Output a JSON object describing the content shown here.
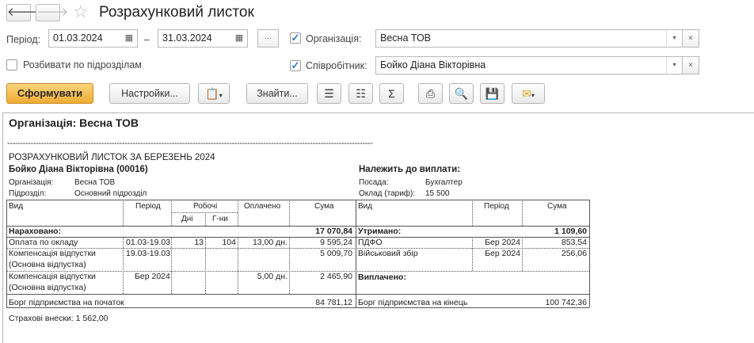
{
  "window": {
    "title": "Розрахунковий листок"
  },
  "filters": {
    "period_label": "Період:",
    "date_from": "01.03.2024",
    "date_sep": "–",
    "date_to": "31.03.2024",
    "more": "...",
    "org_checked": true,
    "org_label": "Організація:",
    "org_value": "Весна ТОВ",
    "split_label": "Розбивати по підрозділам",
    "split_checked": false,
    "emp_checked": true,
    "emp_label": "Співробітник:",
    "emp_value": "Бойко Діана Вікторівна"
  },
  "toolbar": {
    "generate": "Сформувати",
    "settings": "Настройки...",
    "find": "Знайти..."
  },
  "report": {
    "org_header": "Організація: Весна ТОВ",
    "dashes": "--------------------------------------------------------------------------------------------------------------------------------------------",
    "title": "РОЗРАХУНКОВИЙ ЛИСТОК ЗА БЕРЕЗЕНЬ 2024",
    "employee": "Бойко Діана Вікторівна  (00016)",
    "org_label": "Організація:",
    "org_value": "Весна ТОВ",
    "dept_label": "Підрозділ:",
    "dept_value": "Основний підрозділ",
    "payable_label": "Належить до виплати:",
    "position_label": "Посада:",
    "position_value": "Бухгалтер",
    "salary_label": "Оклад (тариф):",
    "salary_value": "15 500",
    "columns": {
      "kind": "Вид",
      "period": "Період",
      "working": "Робочі",
      "days": "Дні",
      "hours": "Г-ни",
      "paid": "Оплачено",
      "sum": "Сума",
      "kind2": "Вид",
      "period2": "Період",
      "sum2": "Сума"
    },
    "accrued_label": "Нараховано:",
    "accrued_total": "17 070,84",
    "withheld_label": "Утримано:",
    "withheld_total": "1 109,60",
    "accruals": [
      {
        "kind": "Оплата по окладу",
        "kind2": "",
        "period": "01.03-19.03",
        "days": "13",
        "hours": "104",
        "paid": "13,00 дн.",
        "sum": "9 595,24"
      },
      {
        "kind": "Компенсація відпустки",
        "kind2": "(Основна відпустка)",
        "period": "19.03-19.03",
        "days": "",
        "hours": "",
        "paid": "",
        "sum": "5 009,70"
      },
      {
        "kind": "Компенсація відпустки",
        "kind2": "(Основна відпустка)",
        "period": "Бер 2024",
        "days": "",
        "hours": "",
        "paid": "5,00 дн.",
        "sum": "2 465,90"
      }
    ],
    "deductions": [
      {
        "kind": "ПДФО",
        "period": "Бер 2024",
        "sum": "853,54"
      },
      {
        "kind": "Військовий збір",
        "period": "Бер 2024",
        "sum": "256,06"
      }
    ],
    "paid_label": "Виплачено:",
    "debt_start_label": "Борг підприємства на початок",
    "debt_start_value": "84 781,12",
    "debt_end_label": "Борг підприємства на кінець",
    "debt_end_value": "100 742,36",
    "insurance": "Страхові внески: 1 562,00"
  }
}
